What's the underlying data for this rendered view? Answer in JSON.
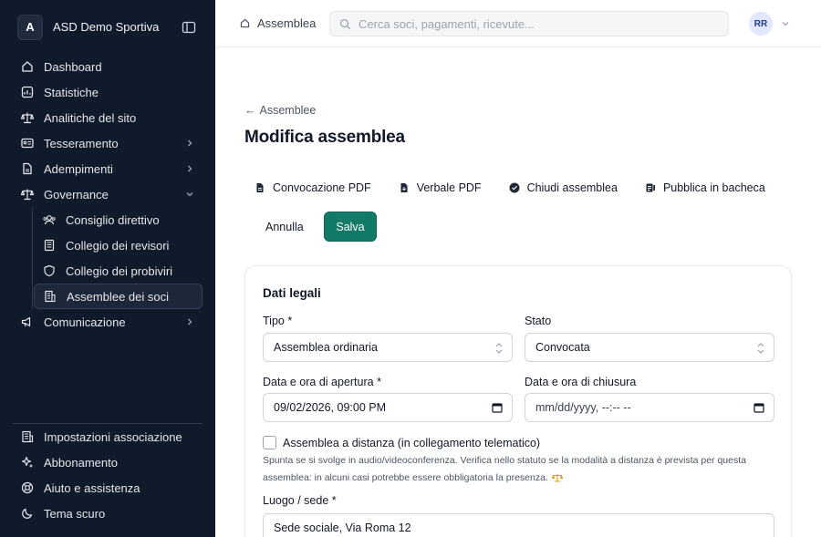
{
  "sidebar": {
    "brand": {
      "initial": "A",
      "name": "ASD Demo Sportiva"
    },
    "items": [
      {
        "label": "Dashboard",
        "icon": "home-icon"
      },
      {
        "label": "Statistiche",
        "icon": "chart-icon"
      },
      {
        "label": "Analitiche del sito",
        "icon": "scale-icon"
      },
      {
        "label": "Tesseramento",
        "icon": "id-card-icon",
        "expandable": true
      },
      {
        "label": "Adempimenti",
        "icon": "document-icon",
        "expandable": true
      },
      {
        "label": "Governance",
        "icon": "balance-icon",
        "expanded": true
      }
    ],
    "governance_items": [
      {
        "label": "Consiglio direttivo",
        "icon": "people-icon"
      },
      {
        "label": "Collegio dei revisori",
        "icon": "ledger-icon"
      },
      {
        "label": "Collegio dei probiviri",
        "icon": "shield-icon"
      },
      {
        "label": "Assemblee dei soci",
        "icon": "building-icon",
        "active": true
      }
    ],
    "comunicazione": {
      "label": "Comunicazione",
      "icon": "megaphone-icon"
    },
    "bottom_items": [
      {
        "label": "Impostazioni associazione",
        "icon": "building-settings-icon"
      },
      {
        "label": "Abbonamento",
        "icon": "sparkle-icon"
      },
      {
        "label": "Aiuto e assistenza",
        "icon": "lifebuoy-icon"
      },
      {
        "label": "Tema scuro",
        "icon": "moon-icon"
      }
    ]
  },
  "topbar": {
    "breadcrumb": "Assemblea",
    "search_placeholder": "Cerca soci, pagamenti, ricevute...",
    "user_initials": "RR"
  },
  "page": {
    "back_link": "Assemblee",
    "title": "Modifica assemblea",
    "actions": [
      {
        "label": "Convocazione PDF",
        "icon": "file-icon"
      },
      {
        "label": "Verbale PDF",
        "icon": "file-download-icon"
      },
      {
        "label": "Chiudi assemblea",
        "icon": "check-circle-icon"
      },
      {
        "label": "Pubblica in bacheca",
        "icon": "board-icon"
      }
    ],
    "cancel_label": "Annulla",
    "save_label": "Salva"
  },
  "form": {
    "section_title": "Dati legali",
    "tipo": {
      "label": "Tipo *",
      "value": "Assemblea ordinaria"
    },
    "stato": {
      "label": "Stato",
      "value": "Convocata"
    },
    "apertura": {
      "label": "Data e ora di apertura *",
      "value": "09/02/2026, 09:00 PM"
    },
    "chiusura": {
      "label": "Data e ora di chiusura",
      "value": "mm/dd/yyyy, --:-- --"
    },
    "distanza": {
      "label": "Assemblea a distanza (in collegamento telematico)",
      "help_1": "Spunta se si svolge in audio/videoconferenza. Verifica nello statuto se la modalità a distanza è prevista per questa",
      "help_2": "assemblea: in alcuni casi potrebbe essere obbligatoria la presenza."
    },
    "luogo": {
      "label": "Luogo / sede *",
      "value": "Sede sociale, Via Roma 12"
    }
  },
  "colors": {
    "sidebar_bg": "#0f1a2b",
    "accent": "#137a68",
    "warning_icon": "#d4a017"
  }
}
